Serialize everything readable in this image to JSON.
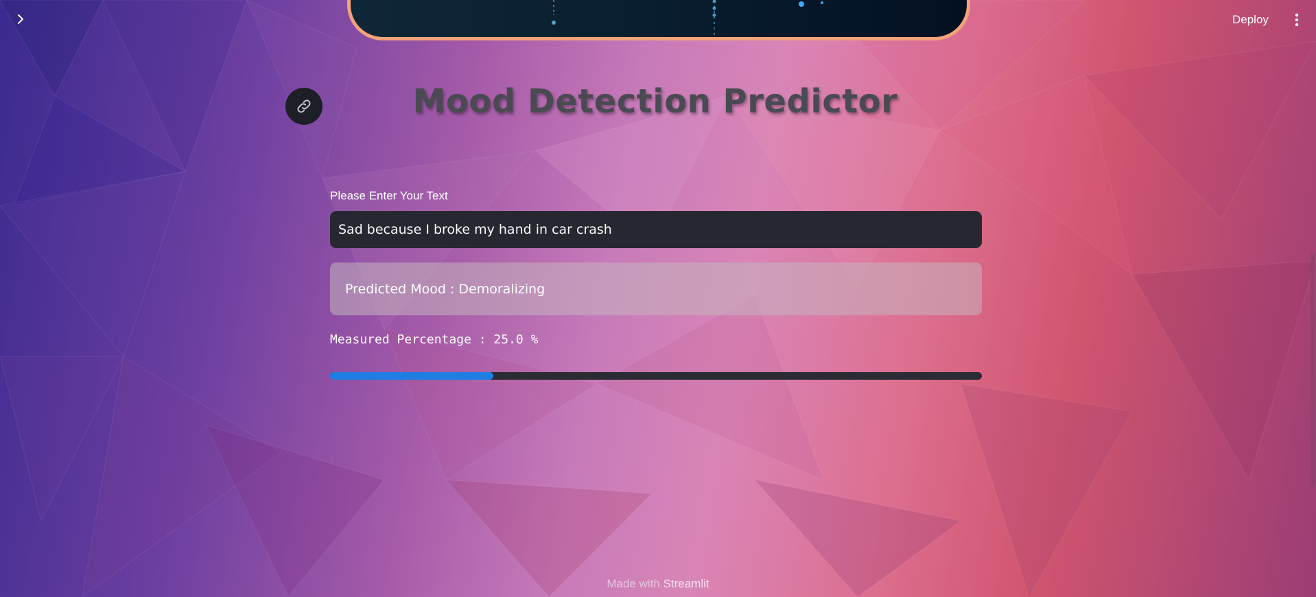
{
  "header": {
    "deploy_label": "Deploy",
    "sidebar_toggle_icon": "chevron-right-icon",
    "menu_icon": "vertical-dots-icon"
  },
  "main": {
    "title": "Mood Detection Predictor",
    "anchor_icon": "link-icon",
    "input": {
      "label": "Please Enter Your Text",
      "value": "Sad because I broke my hand in car crash"
    },
    "result": {
      "text": "Predicted Mood : Demoralizing"
    },
    "measure": {
      "text": "Measured Percentage : 25.0 %",
      "progress_fraction": 0.25
    }
  },
  "footer": {
    "prefix": "Made with",
    "brand": "Streamlit"
  },
  "colors": {
    "progress_fill": "#1f7ee3",
    "input_background": "#262730",
    "hero_border": "#f2a37a"
  }
}
